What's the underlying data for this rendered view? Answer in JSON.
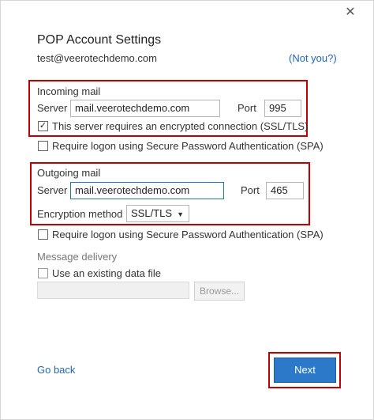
{
  "dialog": {
    "close_glyph": "✕",
    "title": "POP Account Settings",
    "email": "test@veerotechdemo.com",
    "not_you": "(Not you?)"
  },
  "incoming": {
    "heading": "Incoming mail",
    "server_label": "Server",
    "server_value": "mail.veerotechdemo.com",
    "port_label": "Port",
    "port_value": "995",
    "ssl_label": "This server requires an encrypted connection (SSL/TLS)",
    "ssl_checked": true
  },
  "spa_incoming": {
    "label": "Require logon using Secure Password Authentication (SPA)",
    "checked": false
  },
  "outgoing": {
    "heading": "Outgoing mail",
    "server_label": "Server",
    "server_value": "mail.veerotechdemo.com",
    "port_label": "Port",
    "port_value": "465",
    "encryption_label": "Encryption method",
    "encryption_value": "SSL/TLS"
  },
  "spa_outgoing": {
    "label": "Require logon using Secure Password Authentication (SPA)",
    "checked": false
  },
  "delivery": {
    "heading": "Message delivery",
    "existing_label": "Use an existing data file",
    "existing_checked": false,
    "path_value": "",
    "browse_label": "Browse..."
  },
  "footer": {
    "go_back": "Go back",
    "next": "Next"
  },
  "colors": {
    "highlight_border": "#c00000",
    "link": "#2266b8",
    "primary_button": "#2b79c8"
  }
}
